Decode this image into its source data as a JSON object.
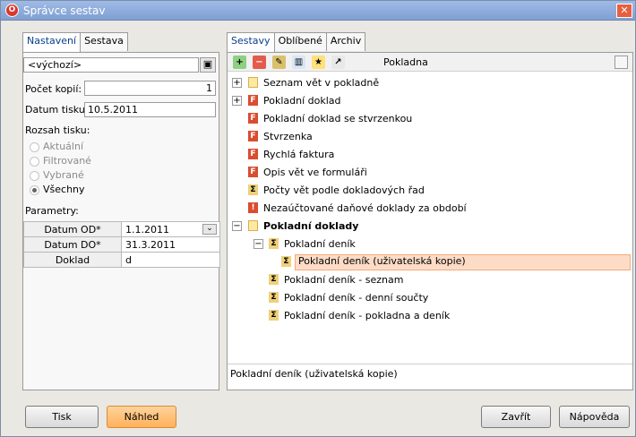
{
  "window": {
    "title": "Správce sestav",
    "app_icon": "O",
    "close_icon": "✕"
  },
  "left_tabs": [
    "Nastavení",
    "Sestava"
  ],
  "settings": {
    "preset_value": "<výchozí>",
    "preset_button_icon": "▣",
    "copies_label": "Počet kopií:",
    "copies_value": "1",
    "print_date_label": "Datum tisku:",
    "print_date_value": "10.5.2011",
    "range_label": "Rozsah tisku:",
    "range_options": [
      "Aktuální",
      "Filtrované",
      "Vybrané",
      "Všechny"
    ],
    "selected_range": "Všechny",
    "params_label": "Parametry:",
    "parameters": [
      {
        "name": "Datum OD*",
        "value": "1.1.2011"
      },
      {
        "name": "Datum DO*",
        "value": "31.3.2011"
      },
      {
        "name": "Doklad",
        "value": "d"
      }
    ]
  },
  "right_tabs": [
    "Sestavy",
    "Oblíbené",
    "Archiv"
  ],
  "toolbar": {
    "context_label": "Pokladna",
    "tools": [
      "add-report-icon",
      "delete-report-icon",
      "edit-report-icon",
      "chart-icon",
      "favorite-icon",
      "export-icon"
    ]
  },
  "tree": [
    {
      "label": "Seznam vět v pokladně",
      "level": 0,
      "expander": "+",
      "icon": "folder-icon"
    },
    {
      "label": "Pokladní doklad",
      "level": 0,
      "expander": "+",
      "icon": "report-icon"
    },
    {
      "label": "Pokladní doklad se stvrzenkou",
      "level": 1,
      "expander": "",
      "icon": "report-icon"
    },
    {
      "label": "Stvrzenka",
      "level": 1,
      "expander": "",
      "icon": "report-icon"
    },
    {
      "label": "Rychlá faktura",
      "level": 1,
      "expander": "",
      "icon": "report-icon"
    },
    {
      "label": "Opis vět ve formuláři",
      "level": 1,
      "expander": "",
      "icon": "report-icon"
    },
    {
      "label": "Počty vět podle dokladových řad",
      "level": 1,
      "expander": "",
      "icon": "sum-icon"
    },
    {
      "label": "Nezaúčtované daňové doklady za období",
      "level": 1,
      "expander": "",
      "icon": "warning-icon"
    },
    {
      "label": "Pokladní doklady",
      "level": 0,
      "expander": "−",
      "icon": "folder-icon",
      "bold": true
    },
    {
      "label": "Pokladní deník",
      "level": 1,
      "expander": "−",
      "icon": "sum-icon"
    },
    {
      "label": "Pokladní deník (uživatelská kopie)",
      "level": 2,
      "expander": "",
      "icon": "sum-icon",
      "selected": true
    },
    {
      "label": "Pokladní deník - seznam",
      "level": 1,
      "expander": "",
      "icon": "sum-icon"
    },
    {
      "label": "Pokladní deník - denní součty",
      "level": 1,
      "expander": "",
      "icon": "sum-icon"
    },
    {
      "label": "Pokladní deník - pokladna a deník",
      "level": 1,
      "expander": "",
      "icon": "sum-icon"
    }
  ],
  "description": "Pokladní deník (uživatelská kopie)",
  "buttons": {
    "print": "Tisk",
    "preview": "Náhled",
    "close": "Zavřít",
    "help": "Nápověda"
  },
  "colors": {
    "selection": "#fddcc7",
    "preview_button": "#ffb15c",
    "title_bar": "#7f9fd3"
  }
}
